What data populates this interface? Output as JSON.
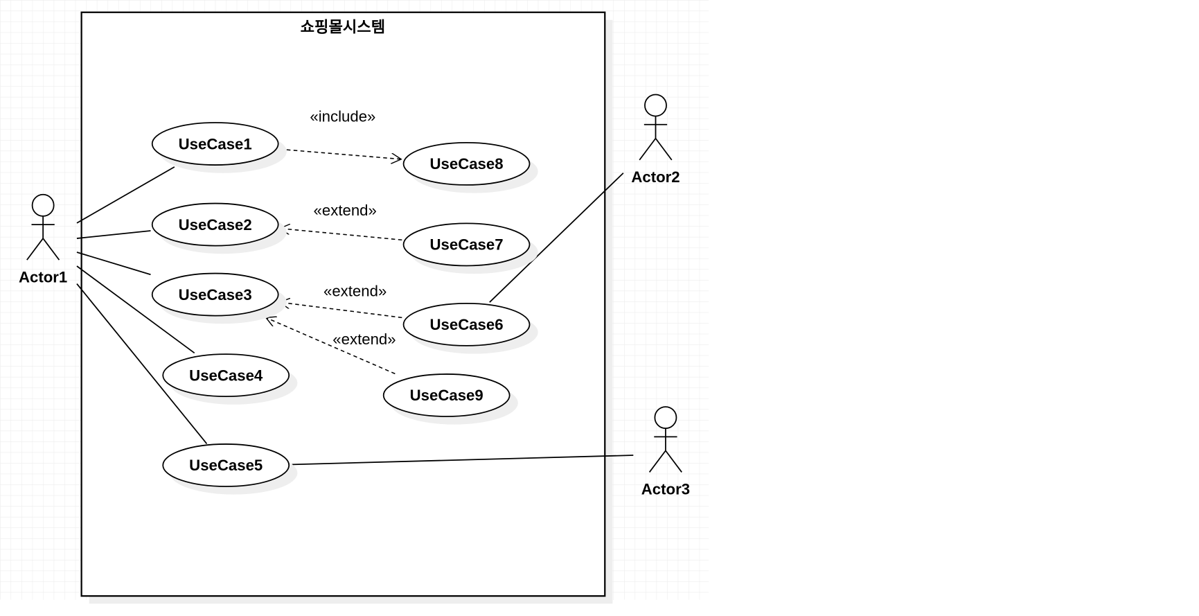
{
  "system": {
    "title": "쇼핑몰시스템"
  },
  "actors": [
    {
      "id": "a1",
      "label": "Actor1"
    },
    {
      "id": "a2",
      "label": "Actor2"
    },
    {
      "id": "a3",
      "label": "Actor3"
    }
  ],
  "use_cases": [
    {
      "id": "u1",
      "label": "UseCase1"
    },
    {
      "id": "u2",
      "label": "UseCase2"
    },
    {
      "id": "u3",
      "label": "UseCase3"
    },
    {
      "id": "u4",
      "label": "UseCase4"
    },
    {
      "id": "u5",
      "label": "UseCase5"
    },
    {
      "id": "u6",
      "label": "UseCase6"
    },
    {
      "id": "u7",
      "label": "UseCase7"
    },
    {
      "id": "u8",
      "label": "UseCase8"
    },
    {
      "id": "u9",
      "label": "UseCase9"
    }
  ],
  "relations": [
    {
      "from": "u1",
      "to": "u8",
      "label": "«include»"
    },
    {
      "from": "u7",
      "to": "u2",
      "label": "«extend»"
    },
    {
      "from": "u6",
      "to": "u3",
      "label": "«extend»"
    },
    {
      "from": "u9",
      "to": "u3",
      "label": "«extend»"
    }
  ],
  "colors": {
    "line": "#000000",
    "grid": "#eeeeee",
    "shadow": "#eeeeee"
  }
}
